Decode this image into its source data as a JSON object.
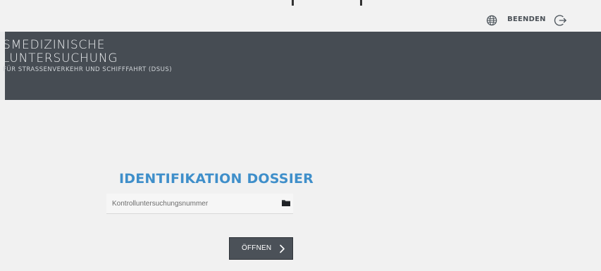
{
  "topbar": {
    "globe_icon": "globe-icon",
    "exit_label": "BEENDEN",
    "exit_icon": "logout-icon"
  },
  "header": {
    "line1": "SMEDIZINISCHE",
    "line2": "LUNTERSUCHUNG",
    "line3": "FÜR STRASSENVERKEHR UND SCHIFFFAHRT (DSUS)"
  },
  "main": {
    "title": "IDENTIFIKATION DOSSIER",
    "control_number": {
      "placeholder": "Kontrolluntersuchungsnummer",
      "value": ""
    },
    "folder_icon": "folder-icon",
    "open_button_label": "ÖFFNEN",
    "open_button_icon": "chevron-right-icon"
  },
  "colors": {
    "topbar": "#f2f2f2",
    "header": "#464c53",
    "title": "#3f8fca",
    "button": "#4b5158"
  }
}
